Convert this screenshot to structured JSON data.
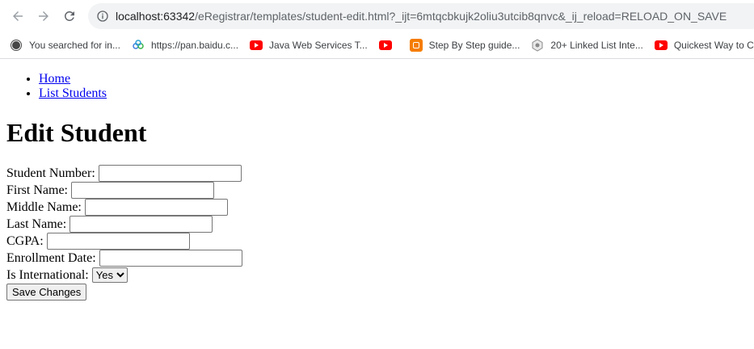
{
  "browser": {
    "url_host": "localhost:63342",
    "url_path": "/eRegistrar/templates/student-edit.html?_ijt=6mtqcbkujk2oliu3utcib8qnvc&_ij_reload=RELOAD_ON_SAVE",
    "bookmarks": [
      {
        "label": "You searched for in...",
        "icon": "wordpress-icon"
      },
      {
        "label": "https://pan.baidu.c...",
        "icon": "baidu-icon"
      },
      {
        "label": "Java Web Services T...",
        "icon": "youtube-icon"
      },
      {
        "label": "",
        "icon": "youtube-icon"
      },
      {
        "label": "Step By Step guide...",
        "icon": "blogger-icon"
      },
      {
        "label": "20+ Linked List Inte...",
        "icon": "site-icon"
      },
      {
        "label": "Quickest Way to Cr...",
        "icon": "youtube-icon"
      }
    ]
  },
  "nav": {
    "home": "Home",
    "list_students": "List Students"
  },
  "page": {
    "title": "Edit Student"
  },
  "form": {
    "student_number_label": "Student Number:",
    "first_name_label": "First Name:",
    "middle_name_label": "Middle Name:",
    "last_name_label": "Last Name:",
    "cgpa_label": "CGPA:",
    "enrollment_date_label": "Enrollment Date:",
    "is_international_label": "Is International:",
    "is_international_value": "Yes",
    "save_label": "Save Changes"
  }
}
